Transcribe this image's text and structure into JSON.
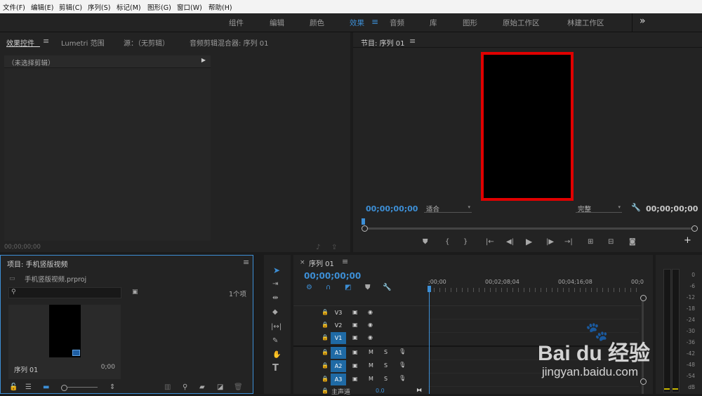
{
  "menu": [
    "文件(F)",
    "编辑(E)",
    "剪辑(C)",
    "序列(S)",
    "标记(M)",
    "图形(G)",
    "窗口(W)",
    "帮助(H)"
  ],
  "workspaces": {
    "tabs": [
      "组件",
      "编辑",
      "颜色",
      "效果",
      "音频",
      "库",
      "图形",
      "原始工作区",
      "林建工作区"
    ],
    "active": "效果",
    "overflow_icon": "chevron-double-right-icon"
  },
  "source_panel": {
    "tabs": [
      "效果控件",
      "Lumetri 范围",
      "源：（无剪辑）",
      "音频剪辑混合器: 序列 01"
    ],
    "active_tab": "效果控件",
    "no_clip_text": "（未选择剪辑）",
    "timecode": "00;00;00;00"
  },
  "program_monitor": {
    "title": "节目: 序列 01",
    "timecode_current": "00;00;00;00",
    "fit_select": "适合",
    "quality_select": "完整",
    "timecode_duration": "00;00;00;00"
  },
  "project_panel": {
    "title": "项目: 手机竖版视频",
    "file_name": "手机竖版视频.prproj",
    "item_count": "1个项",
    "search_placeholder": "",
    "item": {
      "name": "序列 01",
      "duration": "0;00"
    }
  },
  "timeline": {
    "title": "序列 01",
    "timecode": "00;00;00;00",
    "ruler": [
      ";00;00",
      "00;02;08;04",
      "00;04;16;08",
      "00;0"
    ],
    "tracks": [
      {
        "label": "V3",
        "type": "video",
        "selected": false
      },
      {
        "label": "V2",
        "type": "video",
        "selected": false
      },
      {
        "label": "V1",
        "type": "video",
        "selected": true
      },
      {
        "label": "A1",
        "type": "audio",
        "selected": true
      },
      {
        "label": "A2",
        "type": "audio",
        "selected": true
      },
      {
        "label": "A3",
        "type": "audio",
        "selected": true
      }
    ],
    "master_label": "主声道",
    "master_value": "0.0"
  },
  "audio_meter": {
    "labels": [
      "0",
      "-6",
      "-12",
      "-18",
      "-24",
      "-30",
      "-36",
      "-42",
      "-48",
      "-54",
      "dB"
    ]
  },
  "watermark": {
    "brand": "Bai du 经验",
    "url": "jingyan.baidu.com"
  },
  "colors": {
    "accent": "#3d8fd6",
    "highlight_box": "#e00000",
    "track_selected": "#1f6aa5"
  }
}
